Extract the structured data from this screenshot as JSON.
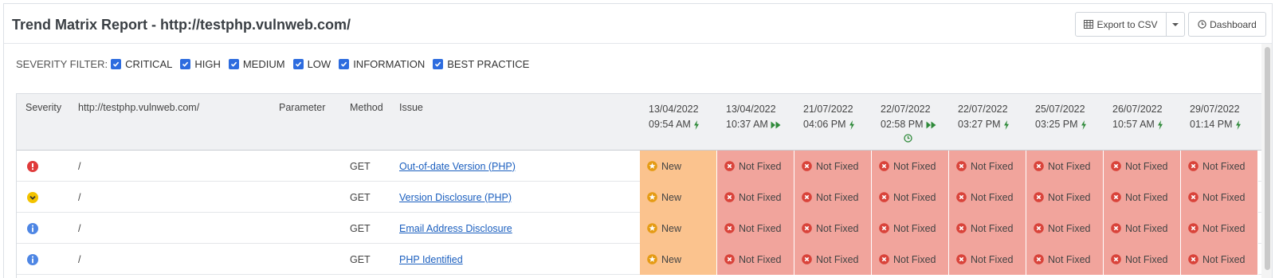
{
  "header": {
    "title": "Trend Matrix Report - http://testphp.vulnweb.com/",
    "export_label": "Export to CSV",
    "dashboard_label": "Dashboard"
  },
  "filter": {
    "label": "SEVERITY FILTER:",
    "items": [
      "CRITICAL",
      "HIGH",
      "MEDIUM",
      "LOW",
      "INFORMATION",
      "BEST PRACTICE"
    ]
  },
  "table": {
    "columns": {
      "severity": "Severity",
      "url": "http://testphp.vulnweb.com/",
      "parameter": "Parameter",
      "method": "Method",
      "issue": "Issue"
    },
    "scans": [
      {
        "date": "13/04/2022",
        "time": "09:54 AM",
        "icon": "lightning-icon"
      },
      {
        "date": "13/04/2022",
        "time": "10:37 AM",
        "icon": "fast-forward-icon"
      },
      {
        "date": "21/07/2022",
        "time": "04:06 PM",
        "icon": "lightning-icon"
      },
      {
        "date": "22/07/2022",
        "time": "02:58 PM",
        "icon": "fast-forward-icon",
        "extra": "clock-icon"
      },
      {
        "date": "22/07/2022",
        "time": "03:27 PM",
        "icon": "lightning-icon"
      },
      {
        "date": "25/07/2022",
        "time": "03:25 PM",
        "icon": "lightning-icon"
      },
      {
        "date": "26/07/2022",
        "time": "10:57 AM",
        "icon": "lightning-icon"
      },
      {
        "date": "29/07/2022",
        "time": "01:14 PM",
        "icon": "lightning-icon"
      }
    ],
    "rows": [
      {
        "severity": "critical",
        "url": "/",
        "parameter": "",
        "method": "GET",
        "issue": "Out-of-date Version (PHP)",
        "statuses": [
          "New",
          "Not Fixed",
          "Not Fixed",
          "Not Fixed",
          "Not Fixed",
          "Not Fixed",
          "Not Fixed",
          "Not Fixed"
        ]
      },
      {
        "severity": "low",
        "url": "/",
        "parameter": "",
        "method": "GET",
        "issue": "Version Disclosure (PHP)",
        "statuses": [
          "New",
          "Not Fixed",
          "Not Fixed",
          "Not Fixed",
          "Not Fixed",
          "Not Fixed",
          "Not Fixed",
          "Not Fixed"
        ]
      },
      {
        "severity": "information",
        "url": "/",
        "parameter": "",
        "method": "GET",
        "issue": "Email Address Disclosure",
        "statuses": [
          "New",
          "Not Fixed",
          "Not Fixed",
          "Not Fixed",
          "Not Fixed",
          "Not Fixed",
          "Not Fixed",
          "Not Fixed"
        ]
      },
      {
        "severity": "information",
        "url": "/",
        "parameter": "",
        "method": "GET",
        "issue": "PHP Identified",
        "statuses": [
          "New",
          "Not Fixed",
          "Not Fixed",
          "Not Fixed",
          "Not Fixed",
          "Not Fixed",
          "Not Fixed",
          "Not Fixed"
        ]
      }
    ]
  },
  "colors": {
    "new_bg": "#fbc38e",
    "not_fixed_bg": "#f1a49c",
    "critical": "#e03b3b",
    "low": "#f3c300",
    "information": "#4e86e4",
    "checkbox": "#2d6cdf",
    "link": "#1b5fbf"
  }
}
